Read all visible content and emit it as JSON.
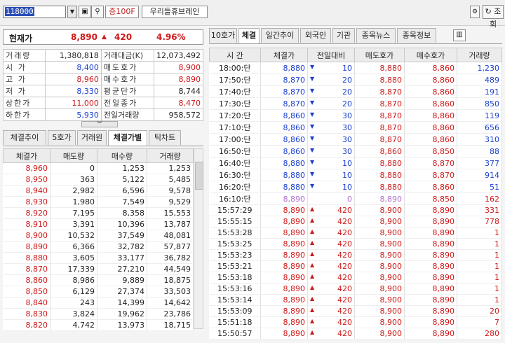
{
  "toolbar": {
    "stock_code": "118000",
    "tag": "증100F",
    "stock_name": "우리들휴브레인",
    "query_label": "조회",
    "dropdown_icon": "chevron-down-icon",
    "settings_icon": "gear-icon",
    "search_icon": "magnifier-icon"
  },
  "current": {
    "label": "현재가",
    "price": "8,890",
    "change": "420",
    "change_dir": "▲",
    "rate": "4.96%"
  },
  "info": {
    "volume_label": "거래량",
    "volume": "1,380,818",
    "amount_label": "거래대금(K)",
    "amount": "12,073,492",
    "rows": [
      {
        "k1": "시 가",
        "v1": "8,400",
        "k2": "매도호가",
        "v2": "8,900"
      },
      {
        "k1": "고 가",
        "v1": "8,960",
        "k2": "매수호가",
        "v2": "8,890"
      },
      {
        "k1": "저 가",
        "v1": "8,330",
        "k2": "평균단가",
        "v2": "8,744"
      },
      {
        "k1": "상한가",
        "v1": "11,000",
        "k2": "전일종가",
        "v2": "8,470"
      },
      {
        "k1": "하한가",
        "v1": "5,930",
        "k2": "전일거래량",
        "v2": "958,572"
      }
    ]
  },
  "left_tabs": [
    "체결추이",
    "5호가",
    "거래원",
    "체결가별",
    "틱차트"
  ],
  "left_table": {
    "headers": [
      "체결가",
      "매도량",
      "매수량",
      "거래량"
    ],
    "rows": [
      [
        "8,960",
        "0",
        "1,253",
        "1,253"
      ],
      [
        "8,950",
        "363",
        "5,122",
        "5,485"
      ],
      [
        "8,940",
        "2,982",
        "6,596",
        "9,578"
      ],
      [
        "8,930",
        "1,980",
        "7,549",
        "9,529"
      ],
      [
        "8,920",
        "7,195",
        "8,358",
        "15,553"
      ],
      [
        "8,910",
        "3,391",
        "10,396",
        "13,787"
      ],
      [
        "8,900",
        "10,532",
        "37,549",
        "48,081"
      ],
      [
        "8,890",
        "6,366",
        "32,782",
        "57,877"
      ],
      [
        "8,880",
        "3,605",
        "33,177",
        "36,782"
      ],
      [
        "8,870",
        "17,339",
        "27,210",
        "44,549"
      ],
      [
        "8,860",
        "8,986",
        "9,889",
        "18,875"
      ],
      [
        "8,850",
        "6,129",
        "27,374",
        "33,503"
      ],
      [
        "8,840",
        "243",
        "14,399",
        "14,642"
      ],
      [
        "8,830",
        "3,824",
        "19,962",
        "23,786"
      ],
      [
        "8,820",
        "4,742",
        "13,973",
        "18,715"
      ]
    ]
  },
  "right_tabs": [
    "10호가",
    "체결",
    "일간추이",
    "외국인",
    "기관",
    "종목뉴스",
    "종목정보"
  ],
  "right_table": {
    "headers": [
      "시 간",
      "체결가",
      "전일대비",
      "매도호가",
      "매수호가",
      "거래량"
    ],
    "rows": [
      {
        "time": "18:00:단",
        "price": "8,880",
        "dir": "▼",
        "chg": "10",
        "ask": "8,880",
        "bid": "8,860",
        "vol": "1,230",
        "c": "blue"
      },
      {
        "time": "17:50:단",
        "price": "8,870",
        "dir": "▼",
        "chg": "20",
        "ask": "8,880",
        "bid": "8,860",
        "vol": "489",
        "c": "blue"
      },
      {
        "time": "17:40:단",
        "price": "8,870",
        "dir": "▼",
        "chg": "20",
        "ask": "8,870",
        "bid": "8,860",
        "vol": "191",
        "c": "blue"
      },
      {
        "time": "17:30:단",
        "price": "8,870",
        "dir": "▼",
        "chg": "20",
        "ask": "8,870",
        "bid": "8,860",
        "vol": "850",
        "c": "blue"
      },
      {
        "time": "17:20:단",
        "price": "8,860",
        "dir": "▼",
        "chg": "30",
        "ask": "8,870",
        "bid": "8,860",
        "vol": "119",
        "c": "blue"
      },
      {
        "time": "17:10:단",
        "price": "8,860",
        "dir": "▼",
        "chg": "30",
        "ask": "8,870",
        "bid": "8,860",
        "vol": "656",
        "c": "blue"
      },
      {
        "time": "17:00:단",
        "price": "8,860",
        "dir": "▼",
        "chg": "30",
        "ask": "8,870",
        "bid": "8,860",
        "vol": "310",
        "c": "blue"
      },
      {
        "time": "16:50:단",
        "price": "8,860",
        "dir": "▼",
        "chg": "30",
        "ask": "8,860",
        "bid": "8,850",
        "vol": "88",
        "c": "blue"
      },
      {
        "time": "16:40:단",
        "price": "8,880",
        "dir": "▼",
        "chg": "10",
        "ask": "8,880",
        "bid": "8,870",
        "vol": "377",
        "c": "blue"
      },
      {
        "time": "16:30:단",
        "price": "8,880",
        "dir": "▼",
        "chg": "10",
        "ask": "8,880",
        "bid": "8,870",
        "vol": "914",
        "c": "blue"
      },
      {
        "time": "16:20:단",
        "price": "8,880",
        "dir": "▼",
        "chg": "10",
        "ask": "8,880",
        "bid": "8,860",
        "vol": "51",
        "c": "blue"
      },
      {
        "time": "16:10:단",
        "price": "8,890",
        "dir": "",
        "chg": "0",
        "ask": "8,890",
        "bid": "8,850",
        "vol": "162",
        "c": "muted"
      },
      {
        "time": "15:57:29",
        "price": "8,890",
        "dir": "▲",
        "chg": "420",
        "ask": "8,900",
        "bid": "8,890",
        "vol": "331",
        "c": "red"
      },
      {
        "time": "15:55:15",
        "price": "8,890",
        "dir": "▲",
        "chg": "420",
        "ask": "8,900",
        "bid": "8,890",
        "vol": "778",
        "c": "red"
      },
      {
        "time": "15:53:28",
        "price": "8,890",
        "dir": "▲",
        "chg": "420",
        "ask": "8,900",
        "bid": "8,890",
        "vol": "1",
        "c": "red"
      },
      {
        "time": "15:53:25",
        "price": "8,890",
        "dir": "▲",
        "chg": "420",
        "ask": "8,900",
        "bid": "8,890",
        "vol": "1",
        "c": "red"
      },
      {
        "time": "15:53:23",
        "price": "8,890",
        "dir": "▲",
        "chg": "420",
        "ask": "8,900",
        "bid": "8,890",
        "vol": "1",
        "c": "red"
      },
      {
        "time": "15:53:21",
        "price": "8,890",
        "dir": "▲",
        "chg": "420",
        "ask": "8,900",
        "bid": "8,890",
        "vol": "1",
        "c": "red"
      },
      {
        "time": "15:53:18",
        "price": "8,890",
        "dir": "▲",
        "chg": "420",
        "ask": "8,900",
        "bid": "8,890",
        "vol": "1",
        "c": "red"
      },
      {
        "time": "15:53:16",
        "price": "8,890",
        "dir": "▲",
        "chg": "420",
        "ask": "8,900",
        "bid": "8,890",
        "vol": "1",
        "c": "red"
      },
      {
        "time": "15:53:14",
        "price": "8,890",
        "dir": "▲",
        "chg": "420",
        "ask": "8,900",
        "bid": "8,890",
        "vol": "1",
        "c": "red"
      },
      {
        "time": "15:53:09",
        "price": "8,890",
        "dir": "▲",
        "chg": "420",
        "ask": "8,900",
        "bid": "8,890",
        "vol": "20",
        "c": "red"
      },
      {
        "time": "15:51:18",
        "price": "8,890",
        "dir": "▲",
        "chg": "420",
        "ask": "8,900",
        "bid": "8,890",
        "vol": "7",
        "c": "red"
      },
      {
        "time": "15:50:57",
        "price": "8,890",
        "dir": "▲",
        "chg": "420",
        "ask": "8,900",
        "bid": "8,890",
        "vol": "280",
        "c": "red"
      }
    ]
  }
}
